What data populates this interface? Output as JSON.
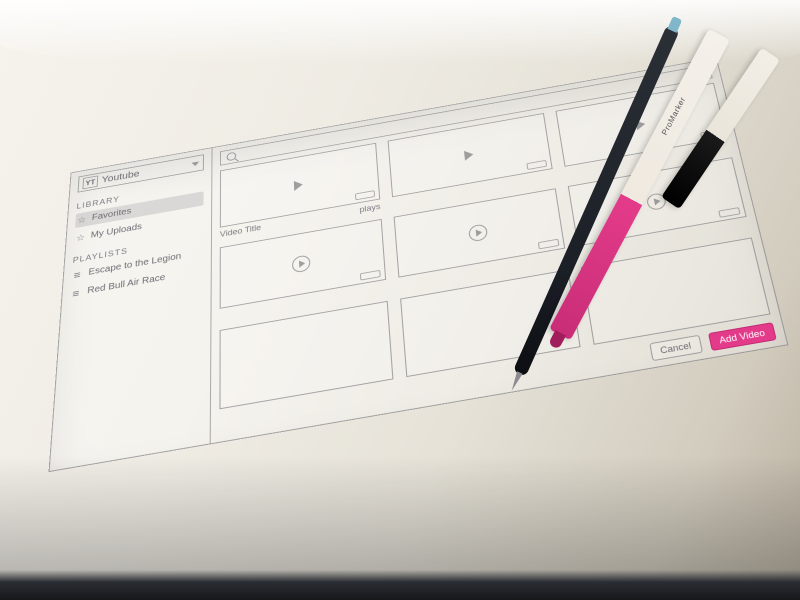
{
  "source": {
    "logo_text": "YT",
    "name": "Youtube"
  },
  "sidebar": {
    "library_label": "LIBRARY",
    "items": [
      {
        "icon": "star",
        "label": "Favorites",
        "selected": true
      },
      {
        "icon": "star",
        "label": "My Uploads",
        "selected": false
      }
    ],
    "playlists_label": "PLAYLISTS",
    "playlists": [
      {
        "label": "Escape to the Legion"
      },
      {
        "label": "Red Bull Air Race"
      }
    ]
  },
  "search": {
    "placeholder": ""
  },
  "video_sample": {
    "title": "Video Title",
    "meta": "plays"
  },
  "footer": {
    "cancel": "Cancel",
    "add": "Add Video"
  },
  "colors": {
    "accent": "#e33b8a"
  }
}
